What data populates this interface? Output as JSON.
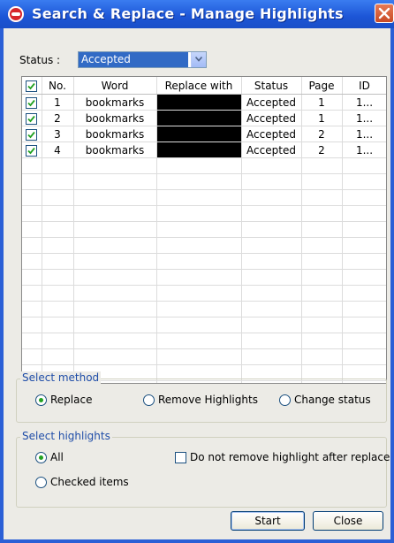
{
  "window": {
    "title": "Search & Replace - Manage Highlights"
  },
  "status": {
    "label": "Status :",
    "selected": "Accepted"
  },
  "table": {
    "columns": [
      "No.",
      "Word",
      "Replace with",
      "Status",
      "Page",
      "ID"
    ],
    "rows": [
      {
        "checked": true,
        "no": "1",
        "word": "bookmarks",
        "status": "Accepted",
        "page": "1",
        "id": "1..."
      },
      {
        "checked": true,
        "no": "2",
        "word": "bookmarks",
        "status": "Accepted",
        "page": "1",
        "id": "1..."
      },
      {
        "checked": true,
        "no": "3",
        "word": "bookmarks",
        "status": "Accepted",
        "page": "2",
        "id": "1..."
      },
      {
        "checked": true,
        "no": "4",
        "word": "bookmarks",
        "status": "Accepted",
        "page": "2",
        "id": "1..."
      }
    ]
  },
  "method": {
    "title": "Select method",
    "options": [
      "Replace",
      "Remove Highlights",
      "Change status"
    ],
    "selected": "Replace"
  },
  "highlights": {
    "title": "Select highlights",
    "all": "All",
    "checked_items": "Checked items",
    "selected": "All",
    "keep_label": "Do not remove highlight after replace",
    "keep_checked": false
  },
  "buttons": {
    "start": "Start",
    "close": "Close"
  },
  "colors": {
    "title_bar": "#1c55d6",
    "selection": "#316ac5",
    "dialog_bg": "#ecebe6",
    "group_title": "#1f4da8"
  }
}
